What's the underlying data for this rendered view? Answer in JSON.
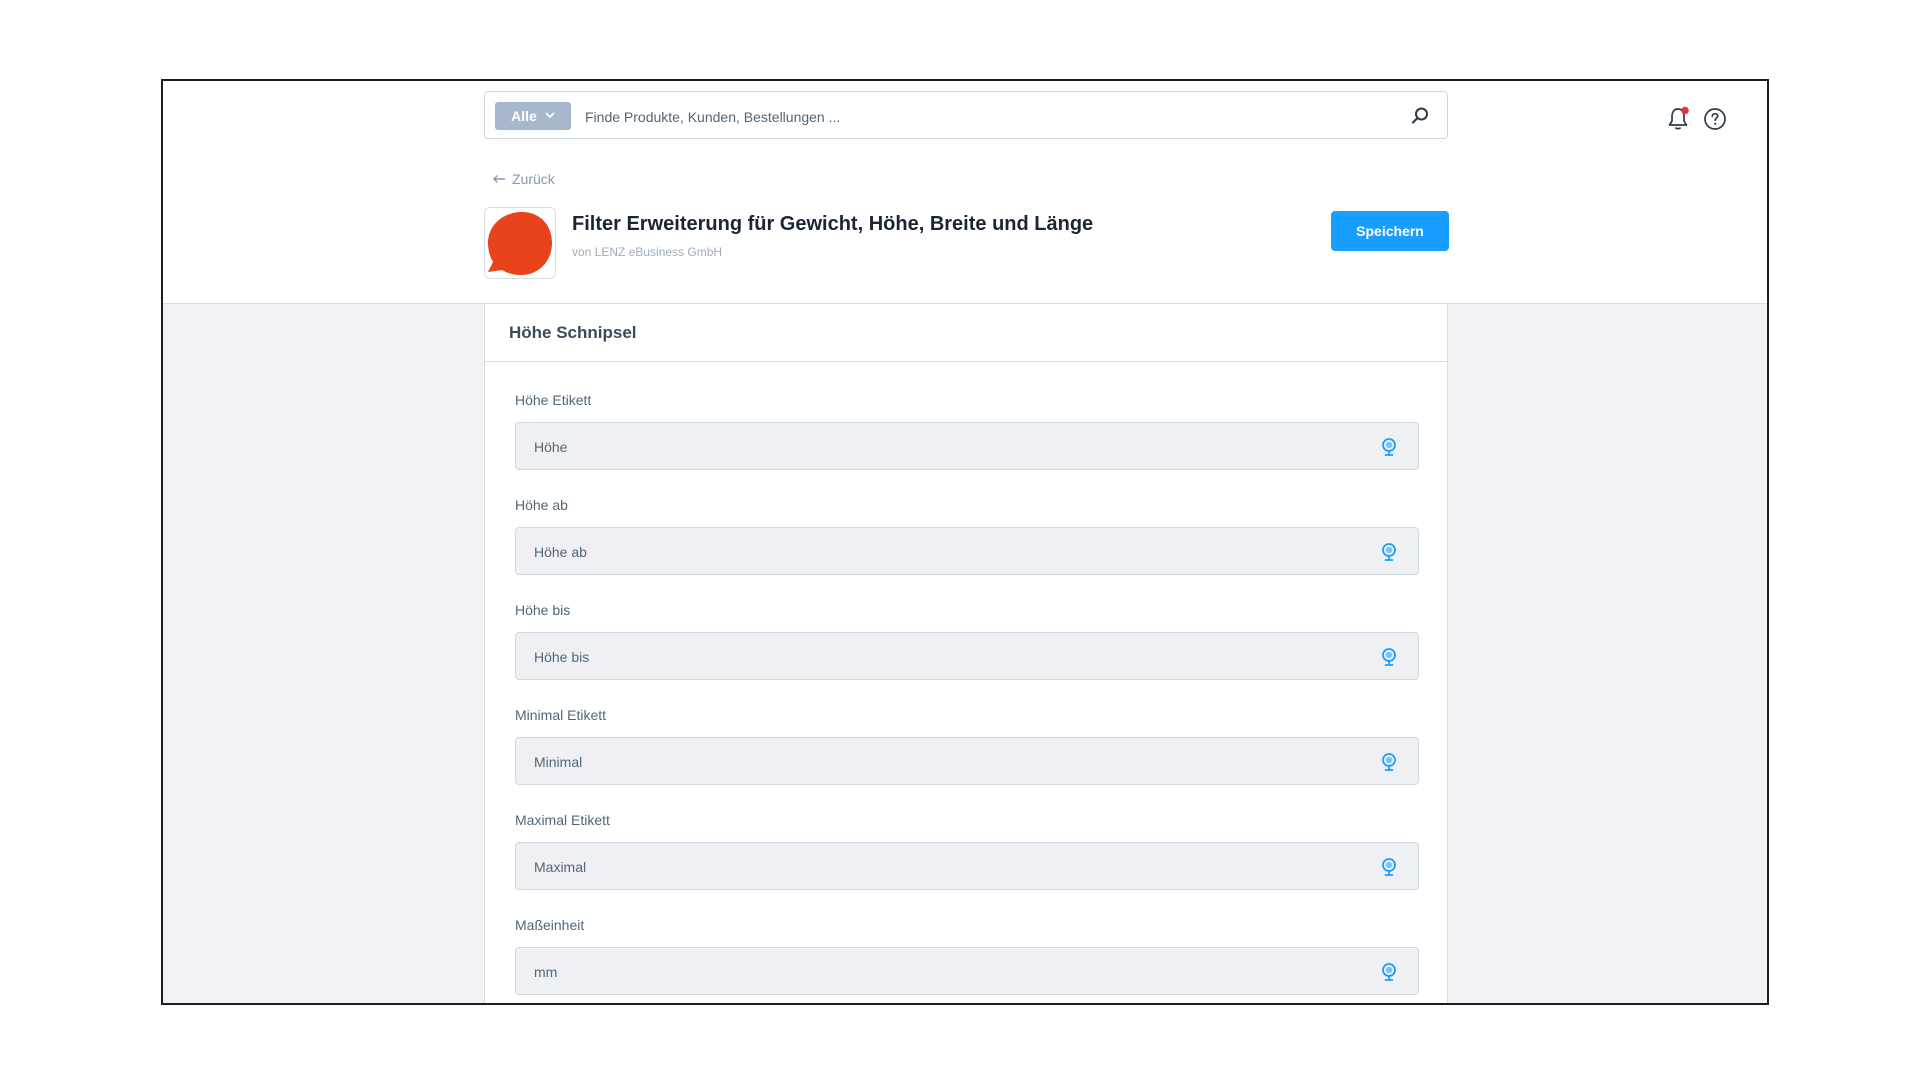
{
  "search": {
    "scope_label": "Alle",
    "placeholder": "Finde Produkte, Kunden, Bestellungen ..."
  },
  "icons": {
    "search": "search-icon",
    "notifications": "bell-icon",
    "help": "help-circle-icon",
    "field_translation": "globe-pin-icon"
  },
  "header": {
    "back_label": "Zurück",
    "title": "Filter Erweiterung für Gewicht, Höhe, Breite und Länge",
    "vendor": "von LENZ eBusiness GmbH",
    "save_label": "Speichern"
  },
  "card": {
    "title": "Höhe Schnipsel",
    "fields": [
      {
        "label": "Höhe Etikett",
        "value": "Höhe"
      },
      {
        "label": "Höhe ab",
        "value": "Höhe ab"
      },
      {
        "label": "Höhe bis",
        "value": "Höhe bis"
      },
      {
        "label": "Minimal Etikett",
        "value": "Minimal"
      },
      {
        "label": "Maximal Etikett",
        "value": "Maximal"
      },
      {
        "label": "Maßeinheit",
        "value": "mm"
      }
    ]
  },
  "colors": {
    "accent": "#189eff",
    "logo": "#e8431a",
    "notification_dot": "#e5323c",
    "scope_bg": "#a8b8cc"
  }
}
